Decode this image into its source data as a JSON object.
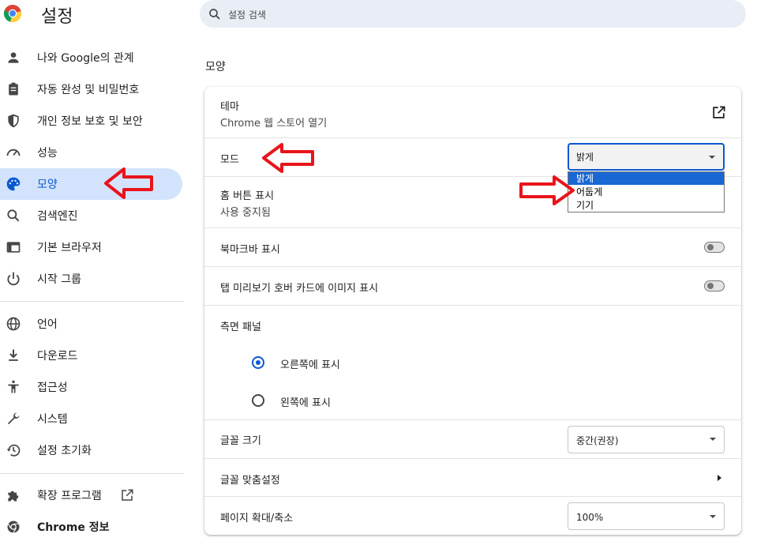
{
  "app": {
    "title": "설정"
  },
  "search": {
    "placeholder": "설정 검색"
  },
  "sidebar": {
    "items": [
      {
        "label": "나와 Google의 관계",
        "icon": "person-icon"
      },
      {
        "label": "자동 완성 및 비밀번호",
        "icon": "clipboard-icon"
      },
      {
        "label": "개인 정보 보호 및 보안",
        "icon": "shield-icon"
      },
      {
        "label": "성능",
        "icon": "speedometer-icon"
      },
      {
        "label": "모양",
        "icon": "palette-icon",
        "selected": true
      },
      {
        "label": "검색엔진",
        "icon": "search-icon"
      },
      {
        "label": "기본 브라우저",
        "icon": "browser-icon"
      },
      {
        "label": "시작 그룹",
        "icon": "power-icon"
      },
      {
        "label": "언어",
        "icon": "globe-icon"
      },
      {
        "label": "다운로드",
        "icon": "download-icon"
      },
      {
        "label": "접근성",
        "icon": "accessibility-icon"
      },
      {
        "label": "시스템",
        "icon": "wrench-icon"
      },
      {
        "label": "설정 초기화",
        "icon": "history-icon"
      },
      {
        "label": "확장 프로그램",
        "icon": "puzzle-icon"
      },
      {
        "label": "Chrome 정보",
        "icon": "chrome-icon"
      }
    ]
  },
  "main": {
    "section_title": "모양",
    "theme": {
      "label": "테마",
      "sublabel": "Chrome 웹 스토어 열기"
    },
    "mode": {
      "label": "모드",
      "selected": "밝게",
      "options": [
        "밝게",
        "어둡게",
        "기기"
      ]
    },
    "home_button": {
      "label": "홈 버튼 표시",
      "sublabel": "사용 중지됨"
    },
    "bookmarks_bar": {
      "label": "북마크바 표시",
      "enabled": false
    },
    "tab_preview": {
      "label": "탭 미리보기 호버 카드에 이미지 표시",
      "enabled": false
    },
    "side_panel": {
      "label": "측면 패널",
      "options": [
        {
          "label": "오른쪽에 표시",
          "checked": true
        },
        {
          "label": "왼쪽에 표시",
          "checked": false
        }
      ]
    },
    "font_size": {
      "label": "글꼴 크기",
      "value": "중간(권장)"
    },
    "customize_fonts": {
      "label": "글꼴 맞춤설정"
    },
    "page_zoom": {
      "label": "페이지 확대/축소",
      "value": "100%"
    }
  },
  "colors": {
    "accent": "#0b57d0",
    "annotation_arrow": "#e8141b"
  }
}
